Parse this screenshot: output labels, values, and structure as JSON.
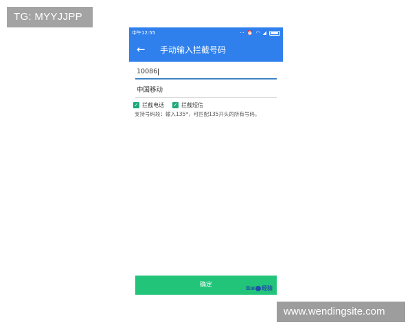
{
  "watermarks": {
    "top_left": "TG: MYYJJPP",
    "bottom_right": "www.wendingsite.com"
  },
  "status_bar": {
    "time": "中午12:55",
    "icons": [
      "more-dots-icon",
      "alarm-icon",
      "wifi-icon",
      "signal-icon",
      "battery-icon"
    ]
  },
  "app_bar": {
    "back_icon": "arrow-left-icon",
    "title": "手动输入拦截号码"
  },
  "form": {
    "number_value": "10086",
    "name_value": "中国移动",
    "checkboxes": [
      {
        "label": "拦截电话",
        "checked": true
      },
      {
        "label": "拦截短信",
        "checked": true
      }
    ],
    "hint": "支持号码段：输入135*，可匹配135开头的所有号码。",
    "confirm_label": "确定"
  },
  "logo": {
    "text_left": "Bai",
    "text_right": "经验"
  },
  "colors": {
    "primary": "#2f80ed",
    "confirm": "#22c47a",
    "checkbox": "#1fa97a",
    "input_focus": "#3b82c4"
  }
}
